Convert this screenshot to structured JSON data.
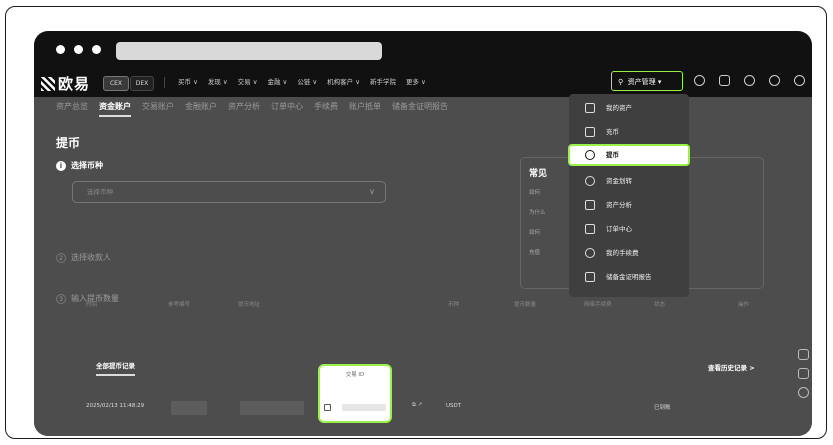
{
  "browser": {
    "title_placeholder": ""
  },
  "nav": {
    "logo_text": "欧易",
    "pill_cex": "CEX",
    "pill_dex": "DEX",
    "menu": [
      "买币 ∨",
      "发现 ∨",
      "交易 ∨",
      "金融 ∨",
      "公链 ∨",
      "机构客户 ∨",
      "新手学院",
      "更多 ∨"
    ],
    "asset_button": "资产管理"
  },
  "subnav": [
    "资产总览",
    "资金账户",
    "交易账户",
    "金融账户",
    "资产分析",
    "订单中心",
    "手续费",
    "账户抵单",
    "储备金证明报告"
  ],
  "page": {
    "title": "提币",
    "step1": "选择币种",
    "coin_placeholder": "选择币种",
    "step2": "选择收款人",
    "step3": "输入提币数量"
  },
  "faq": {
    "title": "常见",
    "lines": [
      "如何",
      "为什么",
      "如何",
      "充值"
    ]
  },
  "records": {
    "tab": "全部提币记录",
    "history_link": "查看历史记录 >",
    "headers": [
      "时间",
      "参考编号",
      "提币地址",
      "交易 ID",
      "币种",
      "提币数量",
      "网络手续费",
      "状态",
      "操作"
    ],
    "row": {
      "time": "2025/02/13 11:48:29",
      "coin": "USDT",
      "status": "已到账"
    }
  },
  "dropdown": {
    "items": [
      {
        "label": "我的资产",
        "icon": "wallet-icon"
      },
      {
        "label": "充币",
        "icon": "deposit-icon"
      },
      {
        "label": "提币",
        "icon": "withdraw-icon"
      },
      {
        "label": "资金划转",
        "icon": "transfer-icon"
      },
      {
        "label": "资产分析",
        "icon": "analysis-icon"
      },
      {
        "label": "订单中心",
        "icon": "order-icon"
      },
      {
        "label": "我的手续费",
        "icon": "fee-icon"
      },
      {
        "label": "储备金证明报告",
        "icon": "report-icon"
      }
    ]
  },
  "tx_popup": {
    "header": "交易 ID"
  },
  "colors": {
    "highlight": "#9cf04a",
    "nav_bg": "#111111",
    "page_bg": "#4d4d4d"
  }
}
